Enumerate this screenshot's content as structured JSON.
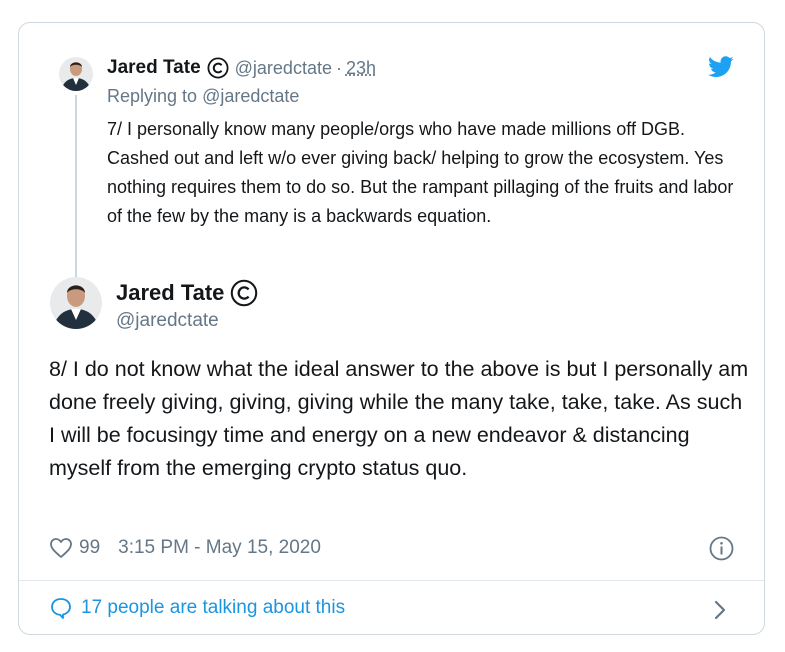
{
  "parent": {
    "name": "Jared Tate",
    "handle": "@jaredctate",
    "separator": "·",
    "time": "23h",
    "replying_prefix": "Replying to ",
    "replying_to": "@jaredctate",
    "text": "7/ I personally know many people/orgs who have made millions off DGB. Cashed out and left w/o ever giving back/ helping to grow the ecosystem. Yes nothing requires them to do so. But the rampant pillaging of the fruits and labor of the few by the many is a backwards equation."
  },
  "main": {
    "name": "Jared Tate",
    "handle": "@jaredctate",
    "text": "8/ I do not know what the ideal answer to the above is but I personally am done freely giving, giving, giving while the many take, take, take. As such I will be focusingy time and energy on a new endeavor & distancing myself from the emerging crypto status quo.",
    "likes": "99",
    "datetime": "3:15 PM - May 15, 2020"
  },
  "footer": {
    "talking": "17 people are talking about this"
  },
  "colors": {
    "twitter_blue": "#1da1f2",
    "link_blue": "#1b95e0",
    "secondary_text": "#657786",
    "border": "#cfd9de"
  },
  "icons": [
    "twitter-bird-icon",
    "copyright-verified-icon",
    "heart-icon",
    "info-icon",
    "speech-bubble-icon",
    "chevron-right-icon"
  ]
}
